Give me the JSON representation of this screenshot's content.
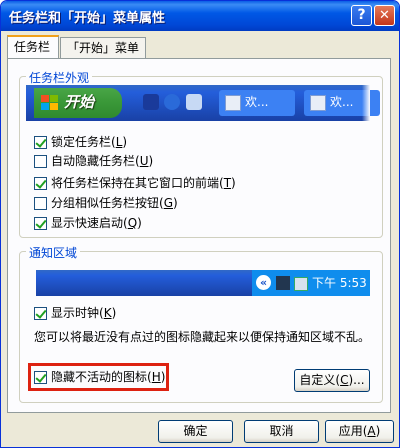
{
  "window": {
    "title": "任务栏和「开始」菜单属性",
    "help_label": "?",
    "close_label": "✕"
  },
  "tabs": [
    {
      "label": "任务栏",
      "active": true
    },
    {
      "label": "「开始」菜单",
      "active": false
    }
  ],
  "appearance": {
    "group_title": "任务栏外观",
    "start_label": "开始",
    "tasks": [
      {
        "label": "欢..."
      },
      {
        "label": "欢..."
      }
    ],
    "options": [
      {
        "label": "锁定任务栏",
        "key": "L",
        "checked": true
      },
      {
        "label": "自动隐藏任务栏",
        "key": "U",
        "checked": false
      },
      {
        "label": "将任务栏保持在其它窗口的前端",
        "key": "T",
        "checked": true
      },
      {
        "label": "分组相似任务栏按钮",
        "key": "G",
        "checked": false
      },
      {
        "label": "显示快速启动",
        "key": "Q",
        "checked": true
      }
    ]
  },
  "notification": {
    "group_title": "通知区域",
    "tray_chevron": "«",
    "tray_time": "下午 5:53",
    "show_clock": {
      "label": "显示时钟",
      "key": "K",
      "checked": true
    },
    "description": "您可以将最近没有点过的图标隐藏起来以便保持通知区域不乱。",
    "hide_inactive": {
      "label": "隐藏不活动的图标",
      "key": "H",
      "checked": true
    },
    "customize_label": "自定义",
    "customize_key": "C",
    "customize_suffix": "..."
  },
  "footer": {
    "ok_label": "确定",
    "cancel_label": "取消",
    "apply_label": "应用",
    "apply_key": "A"
  },
  "colors": {
    "titlebar": "#0058e6",
    "group_title": "#0046d5",
    "highlight_box": "#dd2211",
    "checkmark": "#21a121"
  }
}
